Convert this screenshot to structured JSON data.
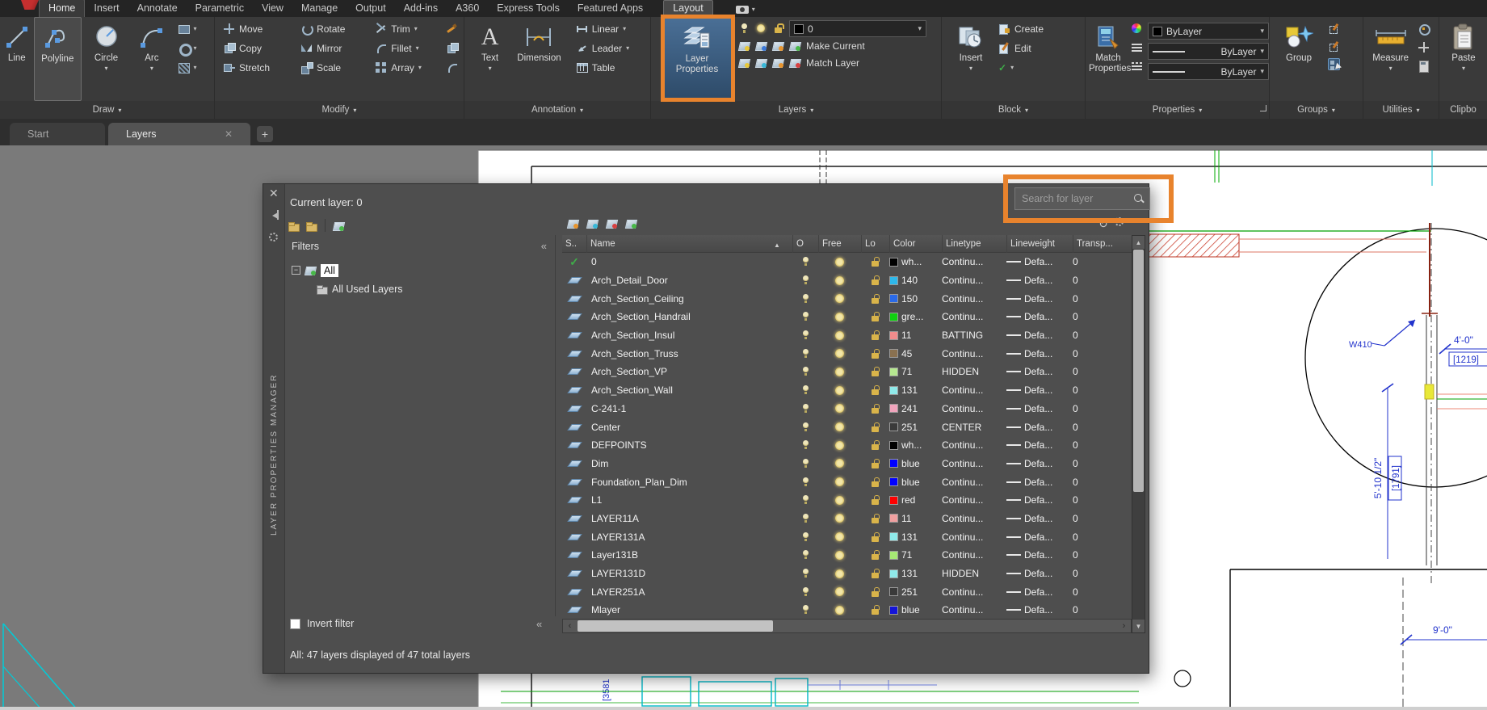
{
  "menubar": {
    "tabs": [
      {
        "label": "Home",
        "active": true
      },
      {
        "label": "Insert"
      },
      {
        "label": "Annotate"
      },
      {
        "label": "Parametric"
      },
      {
        "label": "View"
      },
      {
        "label": "Manage"
      },
      {
        "label": "Output"
      },
      {
        "label": "Add-ins"
      },
      {
        "label": "A360"
      },
      {
        "label": "Express Tools"
      },
      {
        "label": "Featured Apps"
      },
      {
        "label": "Layout",
        "boxed": true
      }
    ]
  },
  "ribbon": {
    "draw": {
      "label": "Draw",
      "line": "Line",
      "polyline": "Polyline",
      "circle": "Circle",
      "arc": "Arc"
    },
    "modify": {
      "label": "Modify",
      "tools": [
        "Move",
        "Copy",
        "Stretch",
        "Rotate",
        "Mirror",
        "Scale",
        "Trim",
        "Fillet",
        "Array"
      ]
    },
    "annotation": {
      "label": "Annotation",
      "text": "Text",
      "dimension": "Dimension",
      "linear": "Linear",
      "leader": "Leader",
      "table": "Table"
    },
    "layers": {
      "label": "Layers",
      "layer_properties": "Layer Properties",
      "combo_value": "0",
      "make_current": "Make Current",
      "match_layer": "Match Layer"
    },
    "block": {
      "label": "Block",
      "insert": "Insert",
      "create": "Create",
      "edit": "Edit"
    },
    "properties": {
      "label": "Properties",
      "match_properties": "Match Properties",
      "bylayer1": "ByLayer",
      "bylayer2": "ByLayer",
      "bylayer3": "ByLayer"
    },
    "groups": {
      "label": "Groups",
      "group": "Group"
    },
    "utilities": {
      "label": "Utilities",
      "measure": "Measure"
    },
    "clipboard": {
      "label": "Clipbo",
      "paste": "Paste"
    }
  },
  "file_tabs": {
    "start": "Start",
    "layers": "Layers"
  },
  "palette": {
    "vertical_title": "LAYER PROPERTIES MANAGER",
    "current_layer": "Current layer: 0",
    "search_placeholder": "Search for layer",
    "filters_header": "Filters",
    "filter_all": "All",
    "filter_all_used": "All Used Layers",
    "invert_filter": "Invert filter",
    "status": "All: 47 layers displayed of 47 total layers",
    "columns": [
      "S..",
      "Name",
      "O",
      "Free",
      "Lo",
      "Color",
      "Linetype",
      "Lineweight",
      "Transp..."
    ],
    "rows": [
      {
        "name": "0",
        "current": true,
        "color": "wh...",
        "hex": "#000000",
        "ltype": "Continu...",
        "lw": "Defa...",
        "tr": "0"
      },
      {
        "name": "Arch_Detail_Door",
        "color": "140",
        "hex": "#2eb8ea",
        "ltype": "Continu...",
        "lw": "Defa...",
        "tr": "0"
      },
      {
        "name": "Arch_Section_Ceiling",
        "color": "150",
        "hex": "#2a6ae8",
        "ltype": "Continu...",
        "lw": "Defa...",
        "tr": "0"
      },
      {
        "name": "Arch_Section_Handrail",
        "color": "gre...",
        "hex": "#10d010",
        "ltype": "Continu...",
        "lw": "Defa...",
        "tr": "0"
      },
      {
        "name": "Arch_Section_Insul",
        "color": "11",
        "hex": "#f08c8c",
        "ltype": "BATTING",
        "lw": "Defa...",
        "tr": "0"
      },
      {
        "name": "Arch_Section_Truss",
        "color": "45",
        "hex": "#8a7150",
        "ltype": "Continu...",
        "lw": "Defa...",
        "tr": "0"
      },
      {
        "name": "Arch_Section_VP",
        "color": "71",
        "hex": "#b6e890",
        "ltype": "HIDDEN",
        "lw": "Defa...",
        "tr": "0"
      },
      {
        "name": "Arch_Section_Wall",
        "color": "131",
        "hex": "#8fe9e9",
        "ltype": "Continu...",
        "lw": "Defa...",
        "tr": "0"
      },
      {
        "name": "C-241-1",
        "color": "241",
        "hex": "#f0a4bc",
        "ltype": "Continu...",
        "lw": "Defa...",
        "tr": "0"
      },
      {
        "name": "Center",
        "color": "251",
        "hex": "#3a3a3a",
        "ltype": "CENTER",
        "lw": "Defa...",
        "tr": "0"
      },
      {
        "name": "DEFPOINTS",
        "color": "wh...",
        "hex": "#000000",
        "ltype": "Continu...",
        "lw": "Defa...",
        "tr": "0"
      },
      {
        "name": "Dim",
        "color": "blue",
        "hex": "#0000ff",
        "ltype": "Continu...",
        "lw": "Defa...",
        "tr": "0"
      },
      {
        "name": "Foundation_Plan_Dim",
        "color": "blue",
        "hex": "#0000ff",
        "ltype": "Continu...",
        "lw": "Defa...",
        "tr": "0"
      },
      {
        "name": "L1",
        "color": "red",
        "hex": "#ff0000",
        "ltype": "Continu...",
        "lw": "Defa...",
        "tr": "0"
      },
      {
        "name": "LAYER11A",
        "color": "11",
        "hex": "#f0a0a0",
        "ltype": "Continu...",
        "lw": "Defa...",
        "tr": "0"
      },
      {
        "name": "LAYER131A",
        "color": "131",
        "hex": "#8fe9e9",
        "ltype": "Continu...",
        "lw": "Defa...",
        "tr": "0"
      },
      {
        "name": "Layer131B",
        "color": "71",
        "hex": "#a6e874",
        "ltype": "Continu...",
        "lw": "Defa...",
        "tr": "0"
      },
      {
        "name": "LAYER131D",
        "color": "131",
        "hex": "#8fe9e9",
        "ltype": "HIDDEN",
        "lw": "Defa...",
        "tr": "0"
      },
      {
        "name": "LAYER251A",
        "color": "251",
        "hex": "#3a3a3a",
        "ltype": "Continu...",
        "lw": "Defa...",
        "tr": "0"
      },
      {
        "name": "Mlayer",
        "color": "blue",
        "hex": "#1414d8",
        "ltype": "Continu...",
        "lw": "Defa...",
        "tr": "0"
      }
    ]
  },
  "drawing": {
    "w410": "W410",
    "dim_4ft": "4'-0\"",
    "dim_1219": "[1219]",
    "dim_5ft": "5'-10 1/2\"",
    "dim_1791": "[1791]",
    "dim_9ft": "9'-0\"",
    "dim_3581": "[3581"
  }
}
